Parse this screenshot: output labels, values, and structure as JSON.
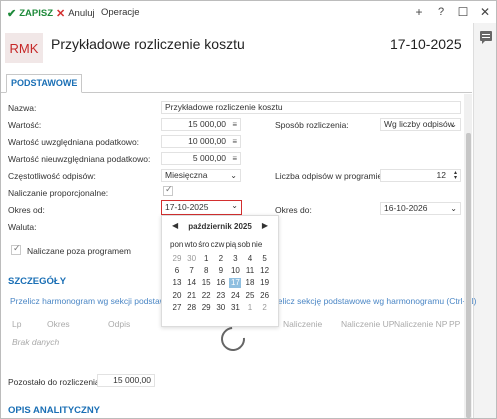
{
  "toolbar": {
    "save": "ZAPISZ",
    "cancel": "Anuluj",
    "operations": "Operacje"
  },
  "header": {
    "logo": "RMK",
    "title": "Przykładowe rozliczenie kosztu",
    "date": "17-10-2025"
  },
  "tabs": {
    "basic": "PODSTAWOWE"
  },
  "form": {
    "name_label": "Nazwa:",
    "name_value": "Przykładowe rozliczenie kosztu",
    "value_label": "Wartość:",
    "value_value": "15 000,00",
    "tax_included_label": "Wartość uwzględniana podatkowo:",
    "tax_included_value": "10 000,00",
    "tax_excluded_label": "Wartość nieuwzględniana podatkowo:",
    "tax_excluded_value": "5 000,00",
    "method_label": "Sposób rozliczenia:",
    "method_value": "Wg liczby odpisów",
    "frequency_label": "Częstotliwość odpisów:",
    "frequency_value": "Miesięczna",
    "count_label": "Liczba odpisów w programie:",
    "count_value": "12",
    "proportional_label": "Naliczanie proporcjonalne:",
    "period_from_label": "Okres od:",
    "period_from_value": "17-10-2025",
    "period_to_label": "Okres do:",
    "period_to_value": "16-10-2026",
    "currency_label": "Waluta:",
    "outside_program_label": "Naliczane poza programem"
  },
  "details": {
    "title": "SZCZEGÓŁY",
    "link_left": "Przelicz harmonogram wg sekcji podstawowej",
    "link_right": "Przelicz sekcję podstawowe wg harmonogramu (Ctrl+N)",
    "columns": [
      "Lp",
      "Okres",
      "Odpis",
      "Naliczenie",
      "Naliczenie UP",
      "Naliczenie NP",
      "PP"
    ],
    "empty_text": "Brak danych",
    "remaining_label": "Pozostało do rozliczenia:",
    "remaining_value": "15 000,00"
  },
  "analytics": {
    "title": "OPIS ANALITYCZNY"
  },
  "calendar": {
    "title": "październik 2025",
    "days_of_week": "pon wto śro czw pią sob nie",
    "selected_day": "17",
    "weeks": [
      [
        "29",
        "30",
        "1",
        "2",
        "3",
        "4",
        "5"
      ],
      [
        "6",
        "7",
        "8",
        "9",
        "10",
        "11",
        "12"
      ],
      [
        "13",
        "14",
        "15",
        "16",
        "17",
        "18",
        "19"
      ],
      [
        "20",
        "21",
        "22",
        "23",
        "24",
        "25",
        "26"
      ],
      [
        "27",
        "28",
        "29",
        "30",
        "31",
        "1",
        "2"
      ]
    ]
  }
}
